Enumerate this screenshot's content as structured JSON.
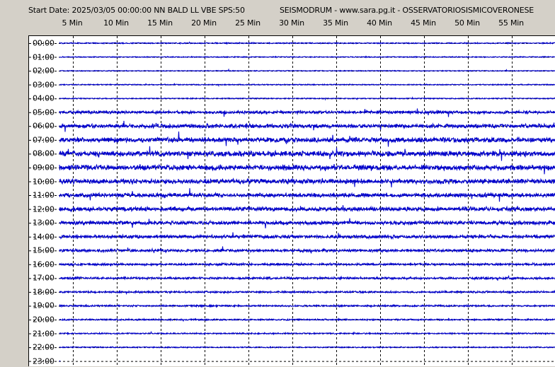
{
  "header": {
    "left": "Start Date: 2025/03/05 00:00:00 NN BALD LL VBE SPS:50",
    "right": "SEISMODRUM - www.sara.pg.it - OSSERVATORIOSISMICOVERONESE"
  },
  "colors": {
    "background": "#d4d0c8",
    "plot_background": "#ffffff",
    "trace": "#0000cc",
    "grid": "#000000"
  },
  "chart_data": {
    "type": "line",
    "title": "SEISMODRUM - www.sara.pg.it - OSSERVATORIOSISMICOVERONESE",
    "xlabel": "",
    "ylabel": "",
    "xlim": [
      0,
      60
    ],
    "x_ticks": [
      5,
      10,
      15,
      20,
      25,
      30,
      35,
      40,
      45,
      50,
      55
    ],
    "x_tick_labels": [
      "5 Min",
      "10 Min",
      "15 Min",
      "20 Min",
      "25 Min",
      "30 Min",
      "35 Min",
      "40 Min",
      "45 Min",
      "50 Min",
      "55 Min"
    ],
    "rows": [
      "00:00",
      "01:00",
      "02:00",
      "03:00",
      "04:00",
      "05:00",
      "06:00",
      "07:00",
      "08:00",
      "09:00",
      "10:00",
      "11:00",
      "12:00",
      "13:00",
      "14:00",
      "15:00",
      "16:00",
      "17:00",
      "18:00",
      "19:00",
      "20:00",
      "21:00",
      "22:00",
      "23:00"
    ],
    "noise_level": [
      0.6,
      0.5,
      0.4,
      0.5,
      0.5,
      1.6,
      2.2,
      2.6,
      2.8,
      2.8,
      2.6,
      2.2,
      2.2,
      2.0,
      1.8,
      1.5,
      1.2,
      1.2,
      1.0,
      0.9,
      0.8,
      0.7,
      0.6,
      0.6
    ],
    "recorded_minutes_last_row": 1.2,
    "grid": true
  }
}
